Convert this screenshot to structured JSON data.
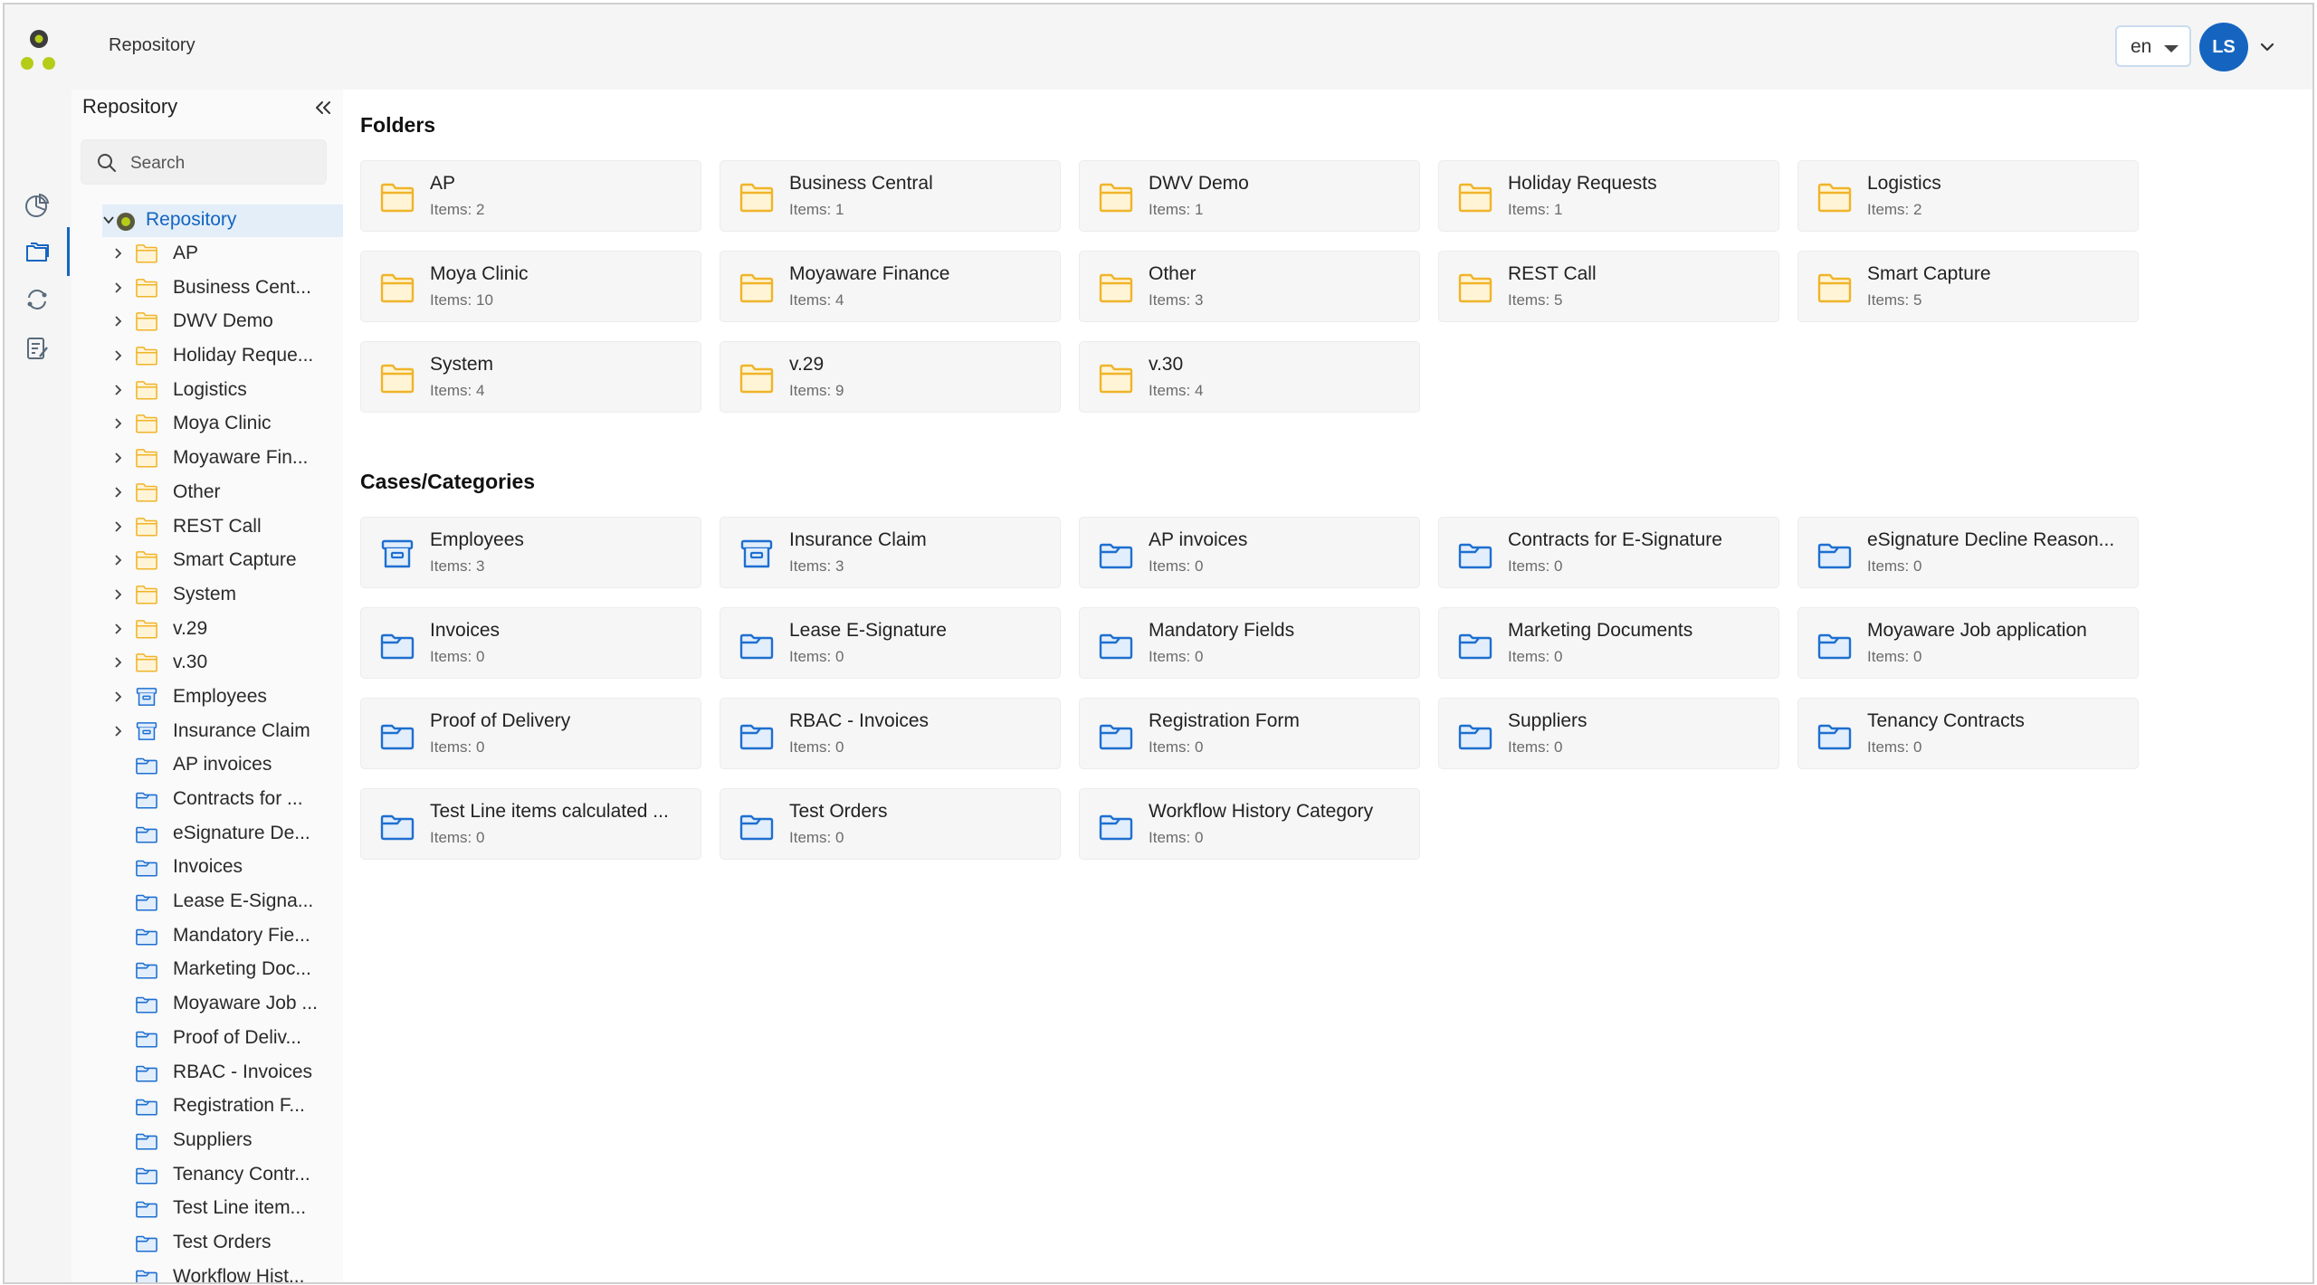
{
  "header": {
    "title": "Repository",
    "language": "en",
    "user_initials": "LS"
  },
  "rail": {
    "items": [
      "dashboard-icon",
      "repository-icon",
      "workflow-icon",
      "tasks-icon"
    ]
  },
  "tree": {
    "title": "Repository",
    "search_placeholder": "Search",
    "root_label": "Repository",
    "items": [
      {
        "label": "AP",
        "type": "folder",
        "expandable": true
      },
      {
        "label": "Business Cent...",
        "type": "folder",
        "expandable": true
      },
      {
        "label": "DWV Demo",
        "type": "folder",
        "expandable": true
      },
      {
        "label": "Holiday Reque...",
        "type": "folder",
        "expandable": true
      },
      {
        "label": "Logistics",
        "type": "folder",
        "expandable": true
      },
      {
        "label": "Moya Clinic",
        "type": "folder",
        "expandable": true
      },
      {
        "label": "Moyaware Fin...",
        "type": "folder",
        "expandable": true
      },
      {
        "label": "Other",
        "type": "folder",
        "expandable": true
      },
      {
        "label": "REST Call",
        "type": "folder",
        "expandable": true
      },
      {
        "label": "Smart Capture",
        "type": "folder",
        "expandable": true
      },
      {
        "label": "System",
        "type": "folder",
        "expandable": true
      },
      {
        "label": "v.29",
        "type": "folder",
        "expandable": true
      },
      {
        "label": "v.30",
        "type": "folder",
        "expandable": true
      },
      {
        "label": "Employees",
        "type": "case",
        "expandable": true
      },
      {
        "label": "Insurance Claim",
        "type": "case",
        "expandable": true
      },
      {
        "label": "AP invoices",
        "type": "category",
        "expandable": false
      },
      {
        "label": "Contracts for ...",
        "type": "category",
        "expandable": false
      },
      {
        "label": "eSignature De...",
        "type": "category",
        "expandable": false
      },
      {
        "label": "Invoices",
        "type": "category",
        "expandable": false
      },
      {
        "label": "Lease E-Signa...",
        "type": "category",
        "expandable": false
      },
      {
        "label": "Mandatory Fie...",
        "type": "category",
        "expandable": false
      },
      {
        "label": "Marketing Doc...",
        "type": "category",
        "expandable": false
      },
      {
        "label": "Moyaware Job ...",
        "type": "category",
        "expandable": false
      },
      {
        "label": "Proof of Deliv...",
        "type": "category",
        "expandable": false
      },
      {
        "label": "RBAC - Invoices",
        "type": "category",
        "expandable": false
      },
      {
        "label": "Registration F...",
        "type": "category",
        "expandable": false
      },
      {
        "label": "Suppliers",
        "type": "category",
        "expandable": false
      },
      {
        "label": "Tenancy Contr...",
        "type": "category",
        "expandable": false
      },
      {
        "label": "Test Line item...",
        "type": "category",
        "expandable": false
      },
      {
        "label": "Test Orders",
        "type": "category",
        "expandable": false
      },
      {
        "label": "Workflow Hist...",
        "type": "category",
        "expandable": false
      }
    ]
  },
  "folders": {
    "title": "Folders",
    "items": [
      {
        "name": "AP",
        "count": "Items: 2"
      },
      {
        "name": "Business Central",
        "count": "Items: 1"
      },
      {
        "name": "DWV Demo",
        "count": "Items: 1"
      },
      {
        "name": "Holiday Requests",
        "count": "Items: 1"
      },
      {
        "name": "Logistics",
        "count": "Items: 2"
      },
      {
        "name": "Moya Clinic",
        "count": "Items: 10"
      },
      {
        "name": "Moyaware Finance",
        "count": "Items: 4"
      },
      {
        "name": "Other",
        "count": "Items: 3"
      },
      {
        "name": "REST Call",
        "count": "Items: 5"
      },
      {
        "name": "Smart Capture",
        "count": "Items: 5"
      },
      {
        "name": "System",
        "count": "Items: 4"
      },
      {
        "name": "v.29",
        "count": "Items: 9"
      },
      {
        "name": "v.30",
        "count": "Items: 4"
      }
    ]
  },
  "cases": {
    "title": "Cases/Categories",
    "items": [
      {
        "name": "Employees",
        "count": "Items: 3",
        "type": "case"
      },
      {
        "name": "Insurance Claim",
        "count": "Items: 3",
        "type": "case"
      },
      {
        "name": "AP invoices",
        "count": "Items: 0",
        "type": "category"
      },
      {
        "name": "Contracts for E-Signature",
        "count": "Items: 0",
        "type": "category"
      },
      {
        "name": "eSignature Decline Reason...",
        "count": "Items: 0",
        "type": "category"
      },
      {
        "name": "Invoices",
        "count": "Items: 0",
        "type": "category"
      },
      {
        "name": "Lease E-Signature",
        "count": "Items: 0",
        "type": "category"
      },
      {
        "name": "Mandatory Fields",
        "count": "Items: 0",
        "type": "category"
      },
      {
        "name": "Marketing Documents",
        "count": "Items: 0",
        "type": "category"
      },
      {
        "name": "Moyaware Job application",
        "count": "Items: 0",
        "type": "category"
      },
      {
        "name": "Proof of Delivery",
        "count": "Items: 0",
        "type": "category"
      },
      {
        "name": "RBAC - Invoices",
        "count": "Items: 0",
        "type": "category"
      },
      {
        "name": "Registration Form",
        "count": "Items: 0",
        "type": "category"
      },
      {
        "name": "Suppliers",
        "count": "Items: 0",
        "type": "category"
      },
      {
        "name": "Tenancy Contracts",
        "count": "Items: 0",
        "type": "category"
      },
      {
        "name": "Test Line items calculated ...",
        "count": "Items: 0",
        "type": "category"
      },
      {
        "name": "Test Orders",
        "count": "Items: 0",
        "type": "category"
      },
      {
        "name": "Workflow History Category",
        "count": "Items: 0",
        "type": "category"
      }
    ]
  },
  "colors": {
    "accent": "#1565c0",
    "folder": "#f0b429",
    "category": "#1e6fd0",
    "selected_bg": "#e3eef9"
  }
}
